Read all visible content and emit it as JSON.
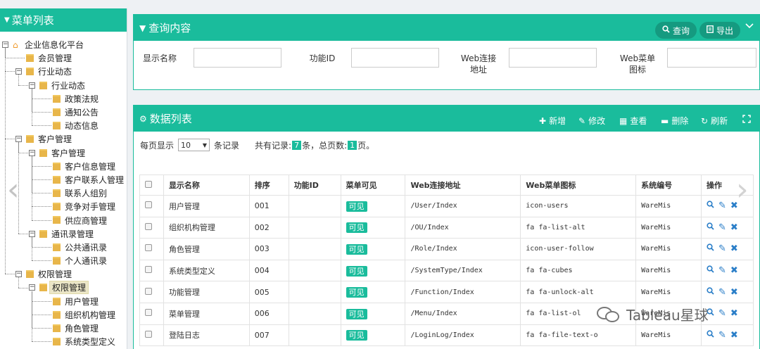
{
  "sidebar": {
    "title": "菜单列表",
    "tree": [
      {
        "label": "企业信息化平台",
        "level": 0,
        "type": "root",
        "expanded": true
      },
      {
        "label": "会员管理",
        "level": 1,
        "type": "leaf"
      },
      {
        "label": "行业动态",
        "level": 1,
        "type": "folder",
        "expanded": true
      },
      {
        "label": "行业动态",
        "level": 2,
        "type": "folder",
        "expanded": true
      },
      {
        "label": "政策法规",
        "level": 3,
        "type": "leaf"
      },
      {
        "label": "通知公告",
        "level": 3,
        "type": "leaf"
      },
      {
        "label": "动态信息",
        "level": 3,
        "type": "leaf"
      },
      {
        "label": "客户管理",
        "level": 1,
        "type": "folder",
        "expanded": true
      },
      {
        "label": "客户管理",
        "level": 2,
        "type": "folder",
        "expanded": true
      },
      {
        "label": "客户信息管理",
        "level": 3,
        "type": "leaf"
      },
      {
        "label": "客户联系人管理",
        "level": 3,
        "type": "leaf"
      },
      {
        "label": "联系人组别",
        "level": 3,
        "type": "leaf"
      },
      {
        "label": "竞争对手管理",
        "level": 3,
        "type": "leaf"
      },
      {
        "label": "供应商管理",
        "level": 3,
        "type": "leaf"
      },
      {
        "label": "通讯录管理",
        "level": 2,
        "type": "folder",
        "expanded": true
      },
      {
        "label": "公共通讯录",
        "level": 3,
        "type": "leaf"
      },
      {
        "label": "个人通讯录",
        "level": 3,
        "type": "leaf"
      },
      {
        "label": "权限管理",
        "level": 1,
        "type": "folder",
        "expanded": true
      },
      {
        "label": "权限管理",
        "level": 2,
        "type": "folder",
        "expanded": true,
        "selected": true
      },
      {
        "label": "用户管理",
        "level": 3,
        "type": "leaf"
      },
      {
        "label": "组织机构管理",
        "level": 3,
        "type": "leaf"
      },
      {
        "label": "角色管理",
        "level": 3,
        "type": "leaf"
      },
      {
        "label": "系统类型定义",
        "level": 3,
        "type": "leaf"
      }
    ]
  },
  "query": {
    "title": "查询内容",
    "search_label": "查询",
    "export_label": "导出",
    "fields": [
      {
        "label": "显示名称",
        "value": ""
      },
      {
        "label": "功能ID",
        "value": ""
      },
      {
        "label": "Web连接地址",
        "line1": "Web连接",
        "line2": "地址",
        "value": ""
      },
      {
        "label": "Web菜单图标",
        "line1": "Web菜单",
        "line2": "图标",
        "value": ""
      }
    ]
  },
  "datalist": {
    "title": "数据列表",
    "toolbar": {
      "add": "新增",
      "edit": "修改",
      "view": "查看",
      "delete": "删除",
      "refresh": "刷新"
    },
    "pager": {
      "prefix": "每页显示",
      "page_size": "10",
      "suffix": "条记录",
      "total_prefix": "共有记录:",
      "total_records": "7",
      "total_mid": "条，总页数:",
      "total_pages": "1",
      "total_suffix": "页。"
    },
    "columns": [
      "显示名称",
      "排序",
      "功能ID",
      "菜单可见",
      "Web连接地址",
      "Web菜单图标",
      "系统编号",
      "操作"
    ],
    "rows": [
      {
        "name": "用户管理",
        "order": "001",
        "func_id": "",
        "visible": "可见",
        "url": "/User/Index",
        "icon": "icon-users",
        "sys": "WareMis"
      },
      {
        "name": "组织机构管理",
        "order": "002",
        "func_id": "",
        "visible": "可见",
        "url": "/OU/Index",
        "icon": "fa fa-list-alt",
        "sys": "WareMis"
      },
      {
        "name": "角色管理",
        "order": "003",
        "func_id": "",
        "visible": "可见",
        "url": "/Role/Index",
        "icon": "icon-user-follow",
        "sys": "WareMis"
      },
      {
        "name": "系统类型定义",
        "order": "004",
        "func_id": "",
        "visible": "可见",
        "url": "/SystemType/Index",
        "icon": "fa fa-cubes",
        "sys": "WareMis"
      },
      {
        "name": "功能管理",
        "order": "005",
        "func_id": "",
        "visible": "可见",
        "url": "/Function/Index",
        "icon": "fa fa-unlock-alt",
        "sys": "WareMis"
      },
      {
        "name": "菜单管理",
        "order": "006",
        "func_id": "",
        "visible": "可见",
        "url": "/Menu/Index",
        "icon": "fa fa-list-ol",
        "sys": "WareMis"
      },
      {
        "name": "登陆日志",
        "order": "007",
        "func_id": "",
        "visible": "可见",
        "url": "/LoginLog/Index",
        "icon": "fa fa-file-text-o",
        "sys": "WareMis"
      }
    ]
  },
  "watermark": {
    "text": "Tableau星球"
  },
  "colors": {
    "accent": "#1abc9c",
    "accent_dark": "#159a80",
    "link": "#2a7ec8"
  }
}
